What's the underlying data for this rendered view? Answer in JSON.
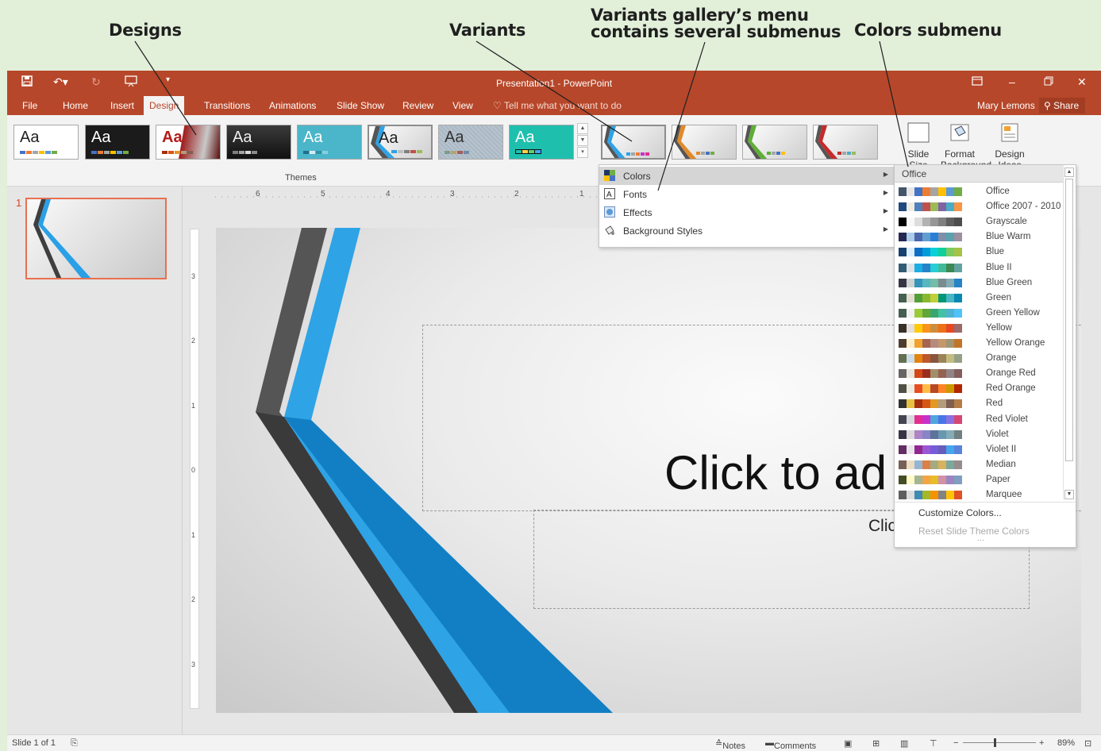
{
  "callouts": {
    "designs": "Designs",
    "variants": "Variants",
    "gallery_menu_line1": "Variants gallery’s menu",
    "gallery_menu_line2": "contains several submenus",
    "colors_submenu": "Colors submenu"
  },
  "window": {
    "title": "Presentation1 - PowerPoint",
    "accent": "#b7472a"
  },
  "tabs": [
    {
      "label": "File"
    },
    {
      "label": "Home"
    },
    {
      "label": "Insert"
    },
    {
      "label": "Design",
      "active": true
    },
    {
      "label": "Transitions"
    },
    {
      "label": "Animations"
    },
    {
      "label": "Slide Show"
    },
    {
      "label": "Review"
    },
    {
      "label": "View"
    }
  ],
  "tell_me": "Tell me what you want to do",
  "user_name": "Mary Lemons",
  "share_label": "Share",
  "themes_group_label": "Themes",
  "theme_sample_text": [
    "Aa",
    "Aa",
    "Aa",
    "Aa",
    "Aa",
    "Aa",
    "Aa",
    "Aa"
  ],
  "ribbon_buttons": {
    "slide_size": "Slide Size",
    "format_background": "Format Background",
    "design_ideas": "Design Ideas"
  },
  "variants_menu": [
    {
      "label": "Colors",
      "icon": "colors-icon"
    },
    {
      "label": "Fonts",
      "icon": "fonts-icon"
    },
    {
      "label": "Effects",
      "icon": "effects-icon"
    },
    {
      "label": "Background Styles",
      "icon": "background-styles-icon"
    }
  ],
  "colors_submenu": {
    "header": "Office",
    "schemes": [
      {
        "name": "Office",
        "colors": [
          "#44546a",
          "#e7e6e6",
          "#4472c4",
          "#ed7d31",
          "#a5a5a5",
          "#ffc000",
          "#5b9bd5",
          "#70ad47"
        ]
      },
      {
        "name": "Office 2007 - 2010",
        "colors": [
          "#1f497d",
          "#eeece1",
          "#4f81bd",
          "#c0504d",
          "#9bbb59",
          "#8064a2",
          "#4bacc6",
          "#f79646"
        ]
      },
      {
        "name": "Grayscale",
        "colors": [
          "#000000",
          "#f8f8f8",
          "#dddddd",
          "#b2b2b2",
          "#969696",
          "#808080",
          "#5f5f5f",
          "#4d4d4d"
        ]
      },
      {
        "name": "Blue Warm",
        "colors": [
          "#242852",
          "#acccea",
          "#4a66ac",
          "#629dd1",
          "#297fd5",
          "#7f8fa9",
          "#5aa2ae",
          "#9d90a0"
        ]
      },
      {
        "name": "Blue",
        "colors": [
          "#17406d",
          "#dbefff",
          "#0f6fc6",
          "#009dd9",
          "#0bd0d9",
          "#10cf9b",
          "#7cca62",
          "#a5c249"
        ]
      },
      {
        "name": "Blue II",
        "colors": [
          "#335b74",
          "#dfe3e5",
          "#1cade4",
          "#2683c6",
          "#27ced7",
          "#42ba97",
          "#3e8853",
          "#62a39f"
        ]
      },
      {
        "name": "Blue Green",
        "colors": [
          "#373545",
          "#ced3d1",
          "#3494ba",
          "#58b6c0",
          "#75bda7",
          "#7a8c8e",
          "#84acb6",
          "#2683c6"
        ]
      },
      {
        "name": "Green",
        "colors": [
          "#455f51",
          "#e3ded1",
          "#549e39",
          "#8ab833",
          "#c0cf3a",
          "#029676",
          "#4ab5c4",
          "#0989b1"
        ]
      },
      {
        "name": "Green Yellow",
        "colors": [
          "#455f51",
          "#f1f1f1",
          "#99cb38",
          "#63a537",
          "#37a76f",
          "#44c1a3",
          "#4eb3cf",
          "#51c3f9"
        ]
      },
      {
        "name": "Yellow",
        "colors": [
          "#39302a",
          "#e5dedb",
          "#ffca08",
          "#f8931d",
          "#ce8d3e",
          "#ec7016",
          "#e64823",
          "#9c6a6a"
        ]
      },
      {
        "name": "Yellow Orange",
        "colors": [
          "#4e3b30",
          "#fbeec9",
          "#f0a22e",
          "#a5644e",
          "#b58b80",
          "#c3986d",
          "#a19574",
          "#c17529"
        ]
      },
      {
        "name": "Orange",
        "colors": [
          "#637052",
          "#ccddea",
          "#e48312",
          "#bd582c",
          "#865640",
          "#9b8357",
          "#c2bc80",
          "#94a088"
        ]
      },
      {
        "name": "Orange Red",
        "colors": [
          "#696464",
          "#e9e5dc",
          "#d34817",
          "#9b2d1f",
          "#a28e6a",
          "#956251",
          "#918485",
          "#855d5d"
        ]
      },
      {
        "name": "Red Orange",
        "colors": [
          "#505046",
          "#eeece1",
          "#e84c22",
          "#ffbd47",
          "#b64926",
          "#ff8427",
          "#cc9900",
          "#b22600"
        ]
      },
      {
        "name": "Red",
        "colors": [
          "#323232",
          "#e5c243",
          "#a5300f",
          "#d55816",
          "#e19825",
          "#b19c7d",
          "#7f5f52",
          "#b27d49"
        ]
      },
      {
        "name": "Red Violet",
        "colors": [
          "#454551",
          "#d8d9dc",
          "#e32d91",
          "#c830cc",
          "#4ea6dc",
          "#4775e7",
          "#8971e1",
          "#d54773"
        ]
      },
      {
        "name": "Violet",
        "colors": [
          "#373545",
          "#dcd8dc",
          "#ad84c6",
          "#8784c7",
          "#5d739a",
          "#6997af",
          "#84acb6",
          "#6f8183"
        ]
      },
      {
        "name": "Violet II",
        "colors": [
          "#632e62",
          "#eae5eb",
          "#92278f",
          "#9b57d3",
          "#755dd9",
          "#665eb8",
          "#45a5ed",
          "#5982db"
        ]
      },
      {
        "name": "Median",
        "colors": [
          "#775f55",
          "#ebddc3",
          "#94b6d2",
          "#dd8047",
          "#a5ab81",
          "#d8b25c",
          "#7ba79d",
          "#968c8c"
        ]
      },
      {
        "name": "Paper",
        "colors": [
          "#444d26",
          "#fefac9",
          "#a5b592",
          "#f3a447",
          "#e7bc29",
          "#d092a7",
          "#9c85c0",
          "#809ec2"
        ]
      },
      {
        "name": "Marquee",
        "colors": [
          "#5e5e5e",
          "#ddddde",
          "#418ab3",
          "#a6b727",
          "#f69200",
          "#838383",
          "#fec306",
          "#df5327"
        ]
      }
    ],
    "customize": "Customize Colors...",
    "reset": "Reset Slide Theme Colors"
  },
  "slide": {
    "thumbnail_number": "1",
    "title_placeholder": "Click to ad",
    "subtitle_placeholder": "Clic"
  },
  "ruler_numbers": {
    "horizontal": [
      "6",
      "5",
      "4",
      "3",
      "2",
      "1"
    ],
    "vertical": [
      "3",
      "2",
      "1",
      "0",
      "1",
      "2",
      "3"
    ]
  },
  "status": {
    "slide_count": "Slide 1 of 1",
    "notes": "Notes",
    "comments": "Comments",
    "zoom": "89%"
  }
}
